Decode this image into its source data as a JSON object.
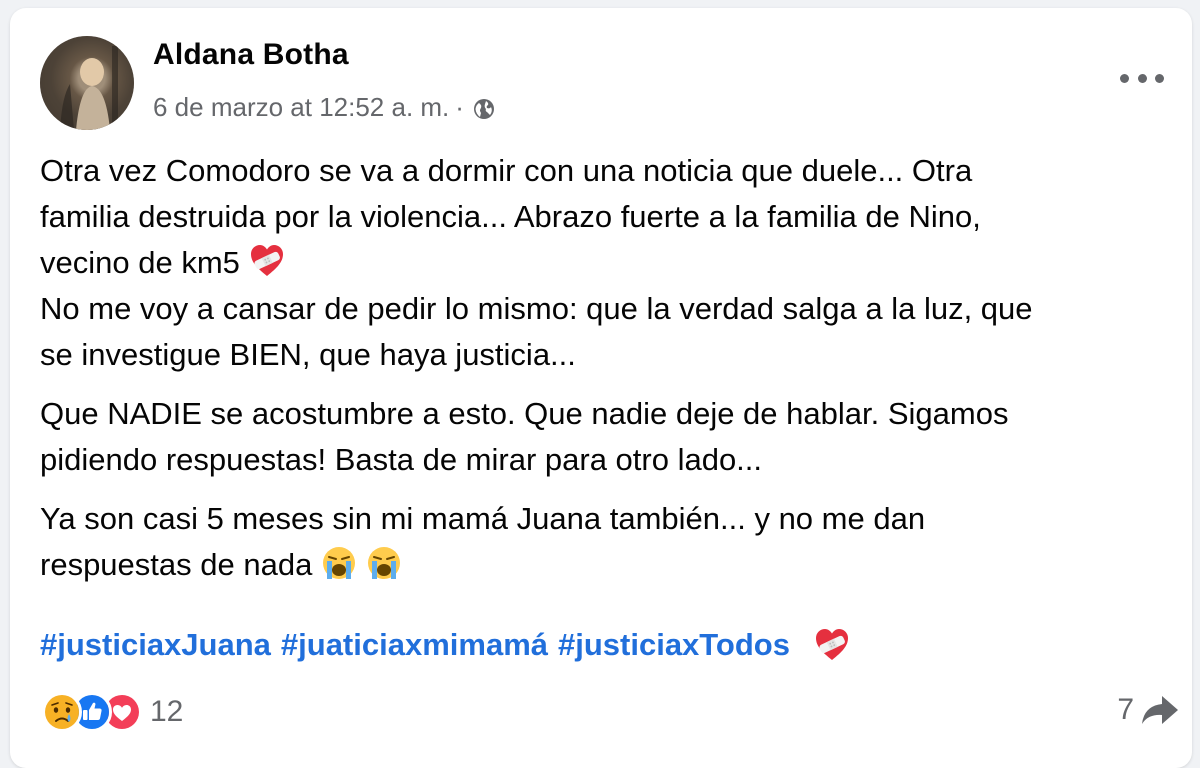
{
  "post": {
    "author": "Aldana Botha",
    "timestamp": "6 de marzo at 12:52 a. m.",
    "separator": "·",
    "audience_icon": "globe-icon",
    "paragraphs": [
      {
        "line1": "Otra vez Comodoro se va a dormir con una noticia que duele... Otra",
        "line2": "familia destruida por la violencia... Abrazo fuerte a la familia de Nino,",
        "line3": "vecino de km5",
        "line4": "No me voy a cansar de pedir lo mismo: que la verdad salga a la luz, que",
        "line5": "se investigue BIEN, que haya justicia..."
      },
      {
        "line1": "Que NADIE se acostumbre a esto. Que nadie deje de hablar. Sigamos",
        "line2": "pidiendo respuestas! Basta de mirar para otro lado..."
      },
      {
        "line1": "Ya son casi 5 meses sin mi mamá Juana  también... y no me dan",
        "line2": "respuestas de nada"
      }
    ],
    "hashtags": [
      "#justiciaxJuana",
      "#juaticiaxmimamá",
      "#justiciaxTodos"
    ],
    "emojis": {
      "heart_bandage": "heart-with-bandage-emoji",
      "crying": "loudly-crying-face-emoji"
    }
  },
  "footer": {
    "reaction_icons": [
      "sad-reaction-icon",
      "like-reaction-icon",
      "love-reaction-icon"
    ],
    "reaction_count": "12",
    "share_count": "7",
    "share_icon": "share-icon"
  },
  "colors": {
    "link": "#216fdb",
    "secondary_text": "#65676b",
    "like_blue": "#1877f2",
    "love_red": "#f33e58",
    "sad_yellow": "#f7b125"
  }
}
